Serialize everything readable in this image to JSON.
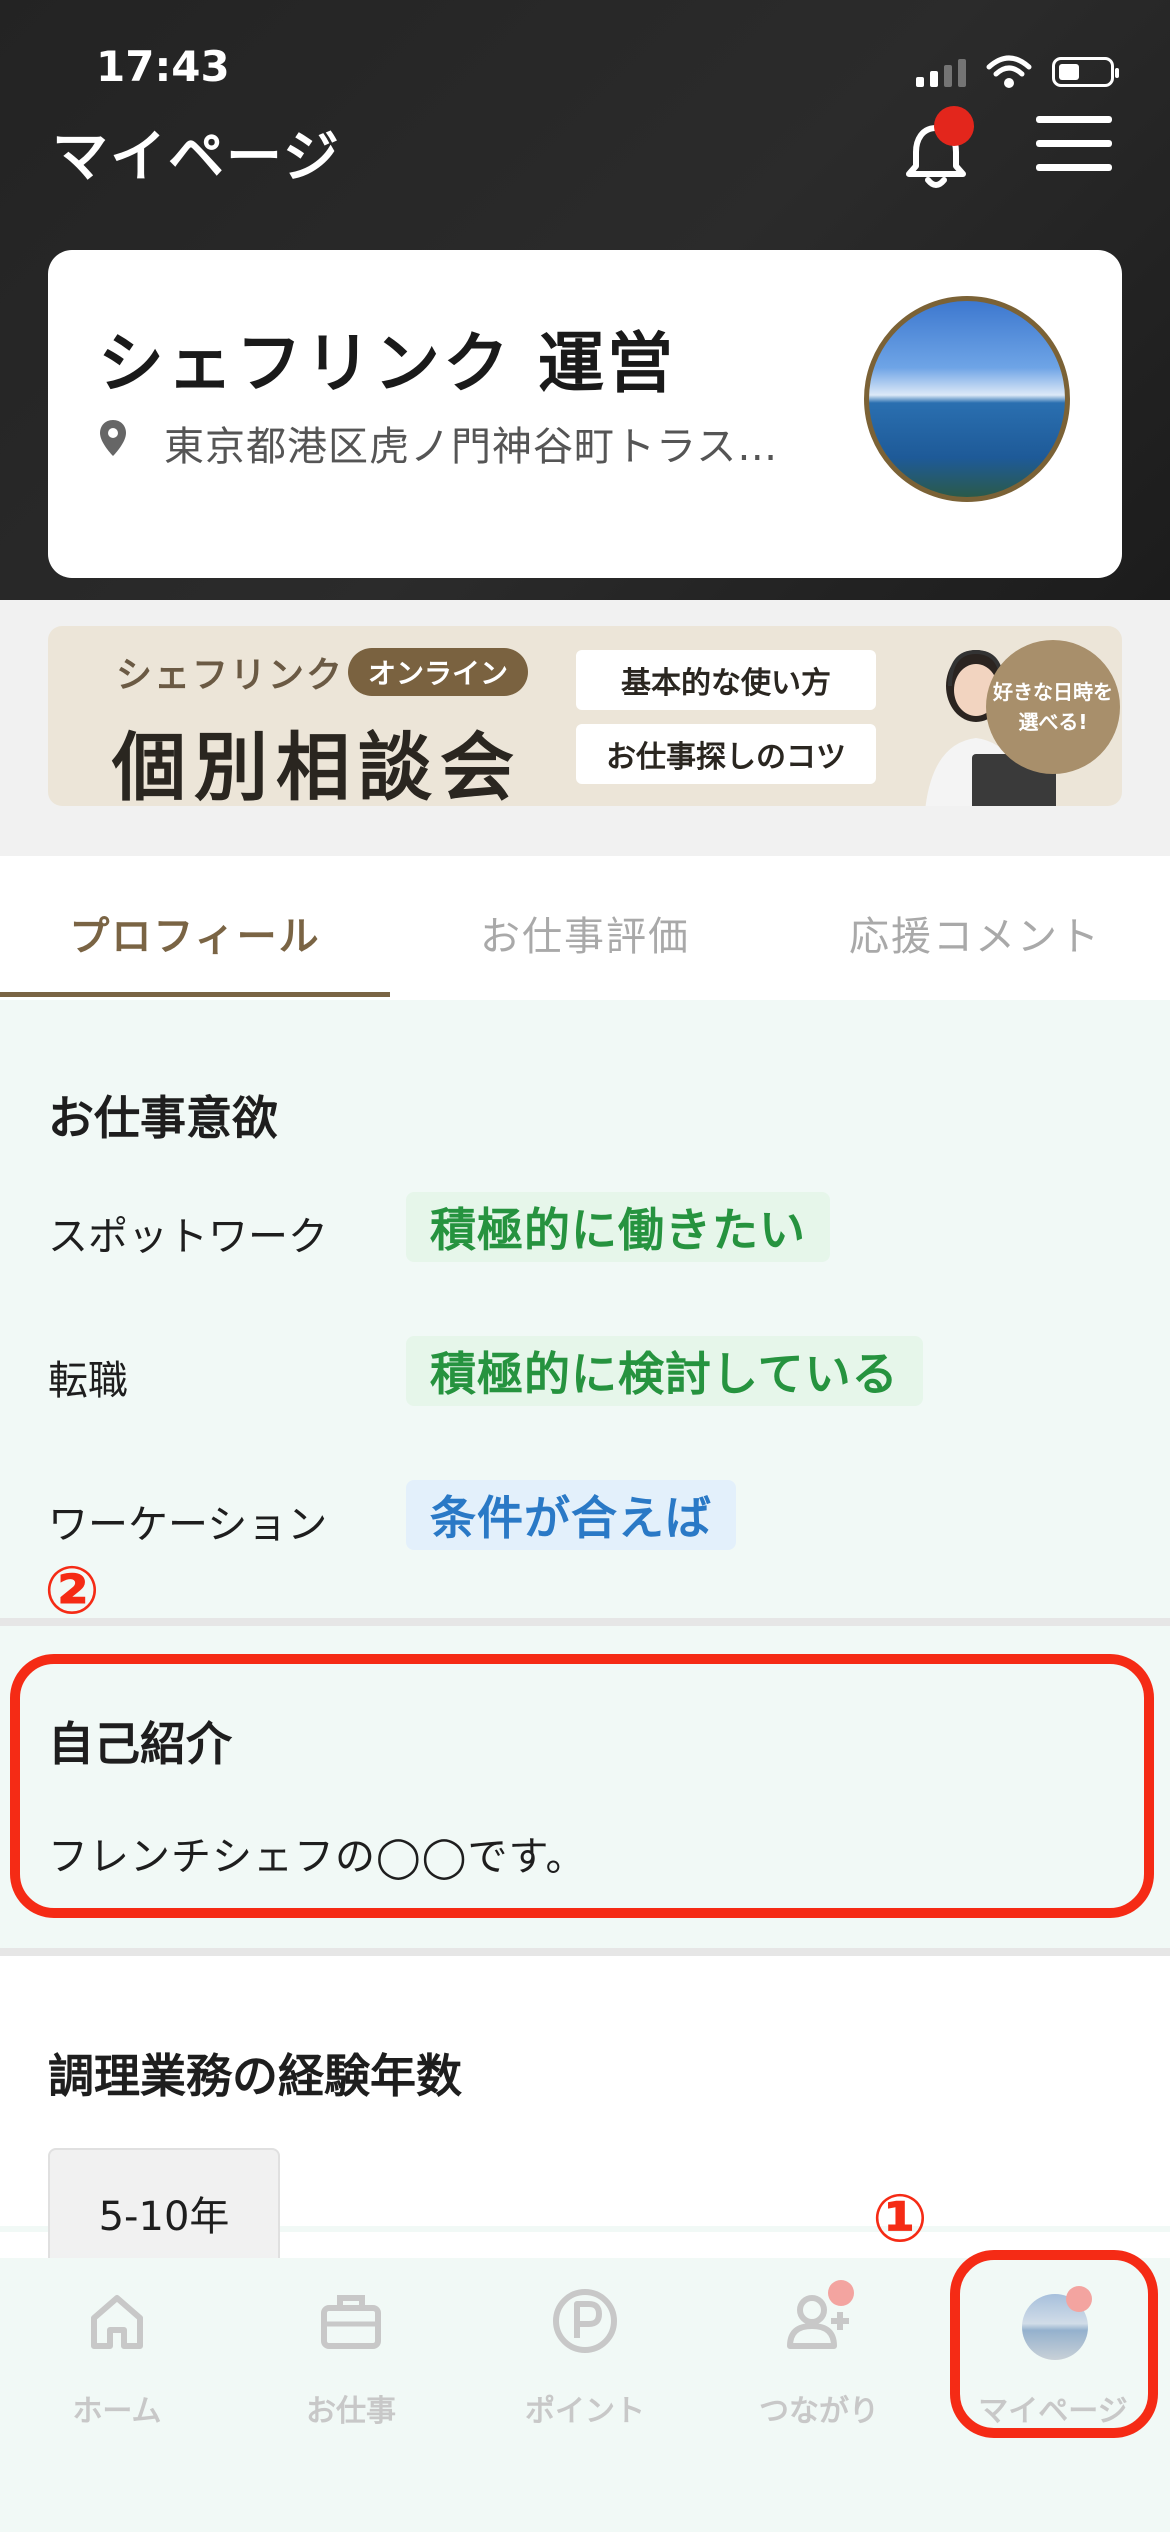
{
  "status_bar": {
    "time": "17:43"
  },
  "header": {
    "title": "マイページ"
  },
  "profile": {
    "name": "シェフリンク 運営",
    "address": "東京都港区虎ノ門神谷町トラス…"
  },
  "banner": {
    "brand": "シェフリンク",
    "online_badge": "オンライン",
    "title": "個別相談会",
    "button_1": "基本的な使い方",
    "button_2": "お仕事探しのコツ",
    "bubble": "好きな日時を選べる!"
  },
  "tabs": [
    {
      "label": "プロフィール",
      "active": true
    },
    {
      "label": "お仕事評価",
      "active": false
    },
    {
      "label": "応援コメント",
      "active": false
    }
  ],
  "work_motivation": {
    "heading": "お仕事意欲",
    "rows": [
      {
        "label": "スポットワーク",
        "value": "積極的に働きたい",
        "color": "#26933f"
      },
      {
        "label": "転職",
        "value": "積極的に検討している",
        "color": "#26933f"
      },
      {
        "label": "ワーケーション",
        "value": "条件が合えば",
        "color": "#2a79c6"
      }
    ]
  },
  "annotations": {
    "marker_1": "①",
    "marker_2": "②",
    "highlight_color": "#f52b15"
  },
  "self_intro": {
    "heading": "自己紹介",
    "text": "フレンチシェフの◯◯です。"
  },
  "experience": {
    "heading": "調理業務の経験年数",
    "value": "5-10年"
  },
  "bottom_nav": [
    {
      "label": "ホーム",
      "icon": "home-icon"
    },
    {
      "label": "お仕事",
      "icon": "briefcase-icon"
    },
    {
      "label": "ポイント",
      "icon": "points-icon"
    },
    {
      "label": "つながり",
      "icon": "add-user-icon"
    },
    {
      "label": "マイページ",
      "icon": "avatar-icon"
    }
  ]
}
